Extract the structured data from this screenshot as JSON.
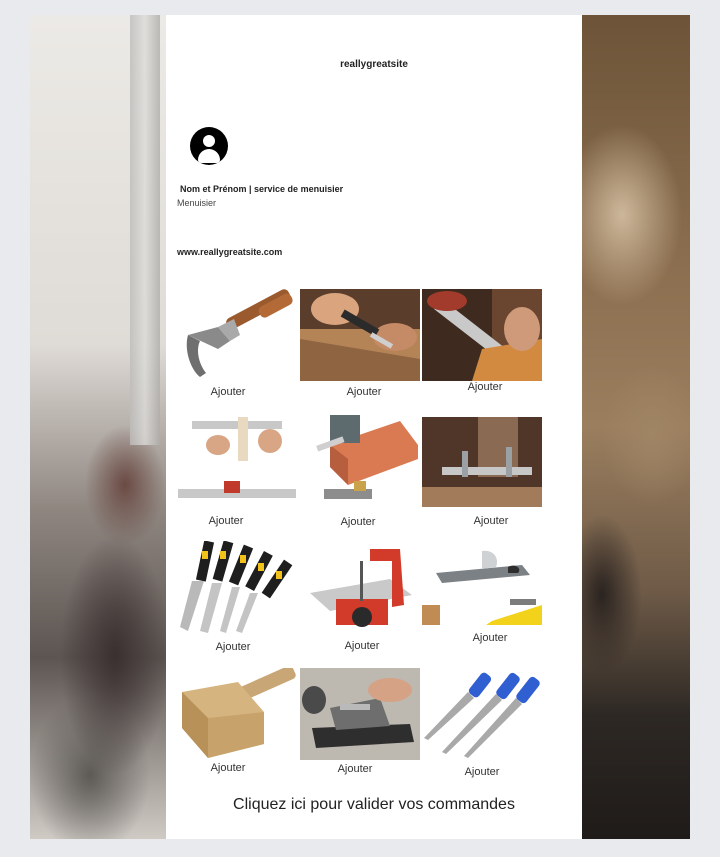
{
  "header": {
    "site_title": "reallygreatsite"
  },
  "profile": {
    "name": "Nom et Prénom | service de menuisier",
    "role": "Menuisier",
    "url": "www.reallygreatsite.com"
  },
  "products": [
    {
      "label": "Ajouter",
      "icon": "claw-hammer-icon"
    },
    {
      "label": "Ajouter",
      "icon": "chisel-wood-icon"
    },
    {
      "label": "Ajouter",
      "icon": "saw-wood-icon"
    },
    {
      "label": "Ajouter",
      "icon": "ruler-square-icon"
    },
    {
      "label": "Ajouter",
      "icon": "bench-plane-block-icon"
    },
    {
      "label": "Ajouter",
      "icon": "miter-clamp-icon"
    },
    {
      "label": "Ajouter",
      "icon": "chisel-set-icon"
    },
    {
      "label": "Ajouter",
      "icon": "scroll-saw-icon"
    },
    {
      "label": "Ajouter",
      "icon": "hand-planes-icon"
    },
    {
      "label": "Ajouter",
      "icon": "wooden-mallet-icon"
    },
    {
      "label": "Ajouter",
      "icon": "jointer-plane-icon"
    },
    {
      "label": "Ajouter",
      "icon": "files-set-icon"
    }
  ],
  "cta": {
    "label": "Cliquez ici pour valider vos commandes"
  }
}
